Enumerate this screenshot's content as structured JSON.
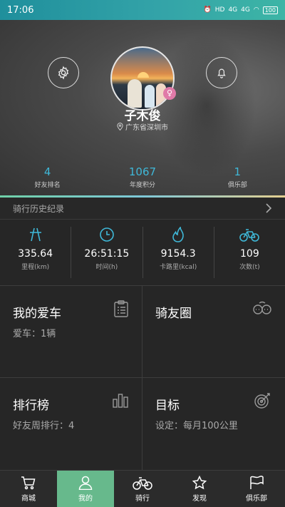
{
  "status_bar": {
    "time": "17:06",
    "network1": "HD",
    "signal1": "4G",
    "signal2": "4G",
    "battery": "100"
  },
  "profile": {
    "username": "子木俊",
    "location": "广东省深圳市",
    "stats": [
      {
        "value": "4",
        "label": "好友排名"
      },
      {
        "value": "1067",
        "label": "年度积分"
      },
      {
        "value": "1",
        "label": "俱乐部"
      }
    ]
  },
  "history": {
    "label": "骑行历史纪录"
  },
  "metrics": [
    {
      "icon": "road-icon",
      "value": "335.64",
      "label": "里程(km)"
    },
    {
      "icon": "clock-icon",
      "value": "26:51:15",
      "label": "时间(h)"
    },
    {
      "icon": "flame-icon",
      "value": "9154.3",
      "label": "卡路里(kcal)"
    },
    {
      "icon": "bicycle-icon",
      "value": "109",
      "label": "次数(t)"
    }
  ],
  "cards": {
    "bike": {
      "title": "我的爱车",
      "sub": "爱车：1辆"
    },
    "circle": {
      "title": "骑友圈"
    },
    "rank": {
      "title": "排行榜",
      "sub": "好友周排行：4"
    },
    "goal": {
      "title": "目标",
      "sub": "设定：每月100公里"
    }
  },
  "nav": [
    {
      "icon": "cart-icon",
      "label": "商城"
    },
    {
      "icon": "user-icon",
      "label": "我的"
    },
    {
      "icon": "bicycle-icon",
      "label": "骑行"
    },
    {
      "icon": "star-icon",
      "label": "发现"
    },
    {
      "icon": "flag-icon",
      "label": "俱乐部"
    }
  ],
  "colors": {
    "accent": "#3fb8d8",
    "nav_active": "#67b98c",
    "status_bar": "#2fa0a8"
  }
}
